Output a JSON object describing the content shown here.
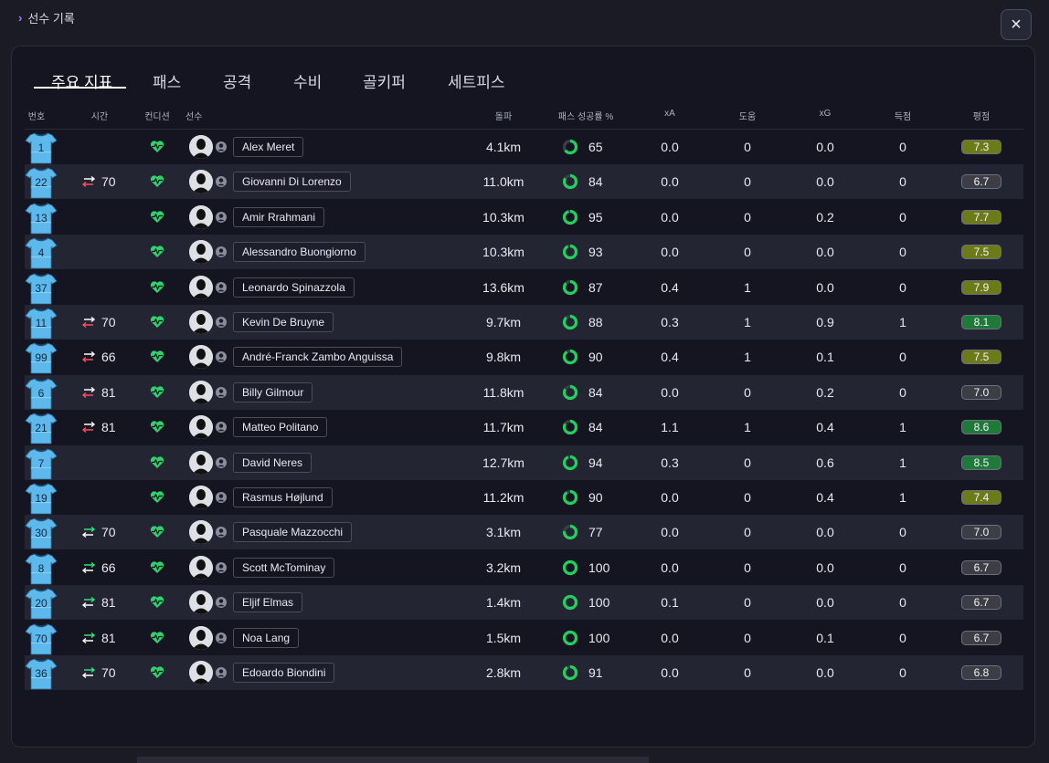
{
  "titlebar": {
    "chevron": "›",
    "title": "선수 기록"
  },
  "close_icon": "×",
  "tabs": [
    "주요 지표",
    "패스",
    "공격",
    "수비",
    "골키퍼",
    "세트피스"
  ],
  "columns": {
    "number": "번호",
    "time": "시간",
    "condition": "컨디션",
    "player": "선수",
    "distance": "돌파",
    "pass_pct": "패스 성공률 %",
    "xa": "xA",
    "assists": "도움",
    "xg": "xG",
    "goals": "득점",
    "rating": "평점"
  },
  "colors": {
    "accent": "#a678ff",
    "jersey": "#5db8ec",
    "heart": "#2fd36e",
    "ring": "#22d05e",
    "sub_out": "#ff4d5e",
    "sub_in": "#36e07a"
  },
  "players": [
    {
      "number": "1",
      "sub": "",
      "time": "",
      "name": "Alex Meret",
      "distance": "4.1km",
      "pass_pct": "65",
      "xa": "0.0",
      "assists": "0",
      "xg": "0.0",
      "goals": "0",
      "rating": "7.3",
      "rating_color": "#6d7a18"
    },
    {
      "number": "22",
      "sub": "out",
      "time": "70",
      "name": "Giovanni Di Lorenzo",
      "distance": "11.0km",
      "pass_pct": "84",
      "xa": "0.0",
      "assists": "0",
      "xg": "0.0",
      "goals": "0",
      "rating": "6.7",
      "rating_color": "#3c3d45"
    },
    {
      "number": "13",
      "sub": "",
      "time": "",
      "name": "Amir Rrahmani",
      "distance": "10.3km",
      "pass_pct": "95",
      "xa": "0.0",
      "assists": "0",
      "xg": "0.2",
      "goals": "0",
      "rating": "7.7",
      "rating_color": "#6d7a18"
    },
    {
      "number": "4",
      "sub": "",
      "time": "",
      "name": "Alessandro Buongiorno",
      "distance": "10.3km",
      "pass_pct": "93",
      "xa": "0.0",
      "assists": "0",
      "xg": "0.0",
      "goals": "0",
      "rating": "7.5",
      "rating_color": "#6d7a18"
    },
    {
      "number": "37",
      "sub": "",
      "time": "",
      "name": "Leonardo Spinazzola",
      "distance": "13.6km",
      "pass_pct": "87",
      "xa": "0.4",
      "assists": "1",
      "xg": "0.0",
      "goals": "0",
      "rating": "7.9",
      "rating_color": "#6d7a18"
    },
    {
      "number": "11",
      "sub": "out",
      "time": "70",
      "name": "Kevin De Bruyne",
      "distance": "9.7km",
      "pass_pct": "88",
      "xa": "0.3",
      "assists": "1",
      "xg": "0.9",
      "goals": "1",
      "rating": "8.1",
      "rating_color": "#1f7a3a"
    },
    {
      "number": "99",
      "sub": "out",
      "time": "66",
      "name": "André-Franck Zambo Anguissa",
      "distance": "9.8km",
      "pass_pct": "90",
      "xa": "0.4",
      "assists": "1",
      "xg": "0.1",
      "goals": "0",
      "rating": "7.5",
      "rating_color": "#6d7a18"
    },
    {
      "number": "6",
      "sub": "out",
      "time": "81",
      "name": "Billy Gilmour",
      "distance": "11.8km",
      "pass_pct": "84",
      "xa": "0.0",
      "assists": "0",
      "xg": "0.2",
      "goals": "0",
      "rating": "7.0",
      "rating_color": "#3c3d45"
    },
    {
      "number": "21",
      "sub": "out",
      "time": "81",
      "name": "Matteo Politano",
      "distance": "11.7km",
      "pass_pct": "84",
      "xa": "1.1",
      "assists": "1",
      "xg": "0.4",
      "goals": "1",
      "rating": "8.6",
      "rating_color": "#1f7a3a"
    },
    {
      "number": "7",
      "sub": "",
      "time": "",
      "name": "David Neres",
      "distance": "12.7km",
      "pass_pct": "94",
      "xa": "0.3",
      "assists": "0",
      "xg": "0.6",
      "goals": "1",
      "rating": "8.5",
      "rating_color": "#1f7a3a"
    },
    {
      "number": "19",
      "sub": "",
      "time": "",
      "name": "Rasmus Højlund",
      "distance": "11.2km",
      "pass_pct": "90",
      "xa": "0.0",
      "assists": "0",
      "xg": "0.4",
      "goals": "1",
      "rating": "7.4",
      "rating_color": "#6d7a18"
    },
    {
      "number": "30",
      "sub": "in",
      "time": "70",
      "name": "Pasquale Mazzocchi",
      "distance": "3.1km",
      "pass_pct": "77",
      "xa": "0.0",
      "assists": "0",
      "xg": "0.0",
      "goals": "0",
      "rating": "7.0",
      "rating_color": "#3c3d45"
    },
    {
      "number": "8",
      "sub": "in",
      "time": "66",
      "name": "Scott McTominay",
      "distance": "3.2km",
      "pass_pct": "100",
      "xa": "0.0",
      "assists": "0",
      "xg": "0.0",
      "goals": "0",
      "rating": "6.7",
      "rating_color": "#3c3d45"
    },
    {
      "number": "20",
      "sub": "in",
      "time": "81",
      "name": "Eljif Elmas",
      "distance": "1.4km",
      "pass_pct": "100",
      "xa": "0.1",
      "assists": "0",
      "xg": "0.0",
      "goals": "0",
      "rating": "6.7",
      "rating_color": "#3c3d45"
    },
    {
      "number": "70",
      "sub": "in",
      "time": "81",
      "name": "Noa Lang",
      "distance": "1.5km",
      "pass_pct": "100",
      "xa": "0.0",
      "assists": "0",
      "xg": "0.1",
      "goals": "0",
      "rating": "6.7",
      "rating_color": "#3c3d45"
    },
    {
      "number": "36",
      "sub": "in",
      "time": "70",
      "name": "Edoardo Biondini",
      "distance": "2.8km",
      "pass_pct": "91",
      "xa": "0.0",
      "assists": "0",
      "xg": "0.0",
      "goals": "0",
      "rating": "6.8",
      "rating_color": "#3c3d45"
    }
  ]
}
